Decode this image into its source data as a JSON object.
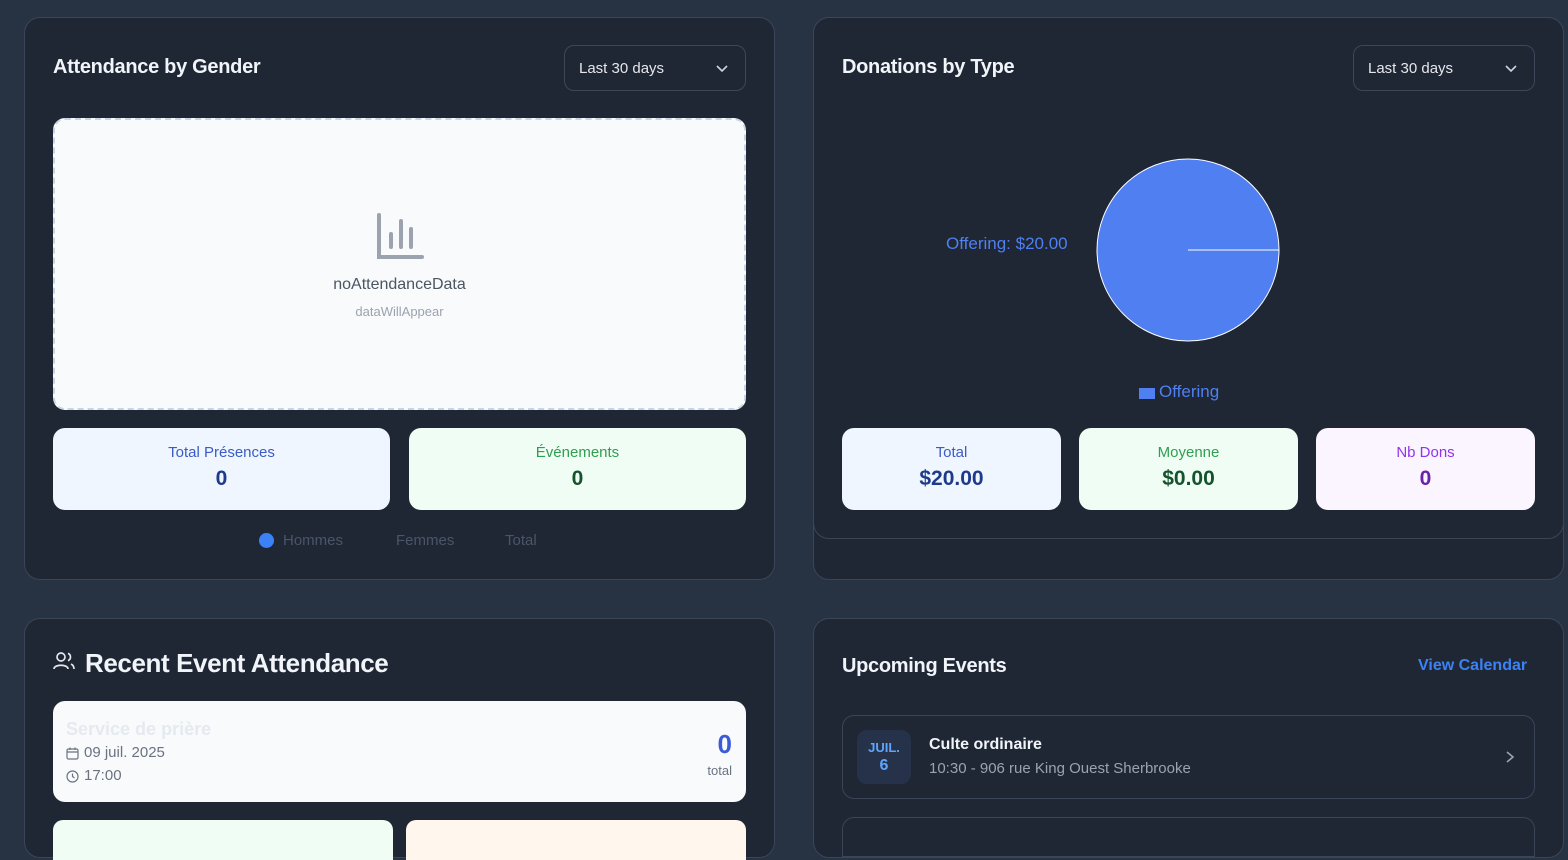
{
  "attendance_card": {
    "title": "Attendance by Gender",
    "range": "Last 30 days",
    "empty_title": "noAttendanceData",
    "empty_sub": "dataWillAppear",
    "stats": [
      {
        "label": "Total Présences",
        "value": "0"
      },
      {
        "label": "Événements",
        "value": "0"
      }
    ],
    "legend": [
      "Hommes",
      "Femmes",
      "Total"
    ]
  },
  "donations_card": {
    "title": "Donations by Type",
    "range": "Last 30 days",
    "slice_label": "Offering: $20.00",
    "legend_label": "Offering",
    "stats": [
      {
        "label": "Total",
        "value": "$20.00"
      },
      {
        "label": "Moyenne",
        "value": "$0.00"
      },
      {
        "label": "Nb Dons",
        "value": "0"
      }
    ]
  },
  "chart_data": {
    "type": "pie",
    "categories": [
      "Offering"
    ],
    "values": [
      20.0
    ],
    "colors": [
      "#4f7ff0"
    ],
    "legend_placement": "bottom"
  },
  "recent_card": {
    "title": "Recent Event Attendance",
    "event": {
      "name": "Service de prière",
      "date": "09 juil. 2025",
      "time": "17:00",
      "count": "0",
      "count_label": "total"
    }
  },
  "upcoming_card": {
    "title": "Upcoming Events",
    "link": "View Calendar",
    "events": [
      {
        "month": "JUIL.",
        "day": "6",
        "name": "Culte ordinaire",
        "details": "10:30 - 906 rue King Ouest Sherbrooke"
      }
    ]
  },
  "colors": {
    "accent": "#60a5fa",
    "pie": "#4f7ff0"
  }
}
